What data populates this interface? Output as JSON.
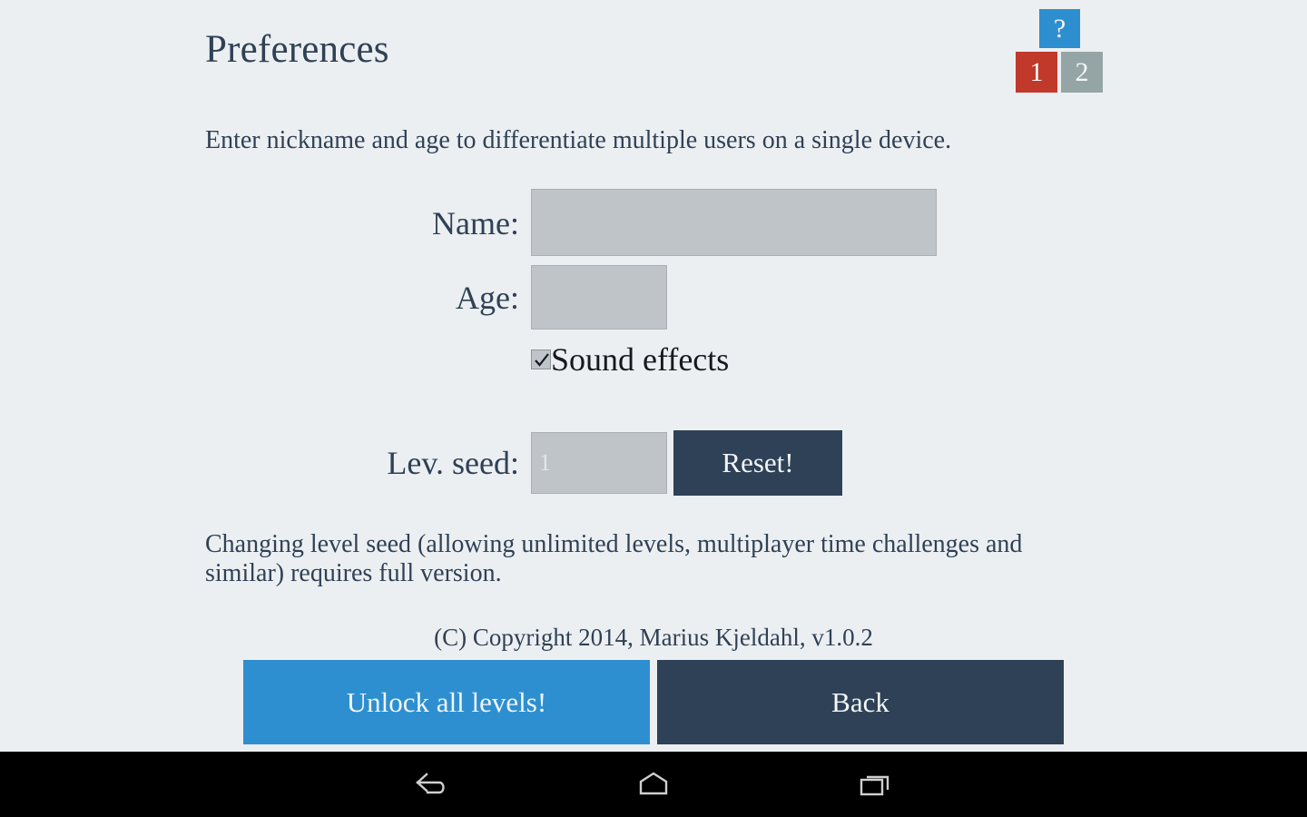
{
  "page": {
    "title": "Preferences",
    "intro": "Enter nickname and age to differentiate multiple users on a single device.",
    "seed_note": "Changing level seed (allowing unlimited levels, multiplayer time challenges and similar) requires full version.",
    "copyright": "(C) Copyright 2014, Marius Kjeldahl, v1.0.2",
    "background_color": "#eceff1",
    "text_color": "#2f4156"
  },
  "tiles": [
    {
      "label": "?",
      "name": "help-tile",
      "color": "#2e8fd0"
    },
    {
      "label": "1",
      "name": "level-tile-1",
      "color": "#c0392b"
    },
    {
      "label": "2",
      "name": "level-tile-2",
      "color": "#95a5a5"
    }
  ],
  "form": {
    "name": {
      "label": "Name:",
      "value": "",
      "placeholder": ""
    },
    "age": {
      "label": "Age:",
      "value": "",
      "placeholder": ""
    },
    "sound_effects": {
      "label": "Sound effects",
      "checked": true,
      "icon": "checkmark-icon"
    },
    "level_seed": {
      "label": "Lev. seed:",
      "value": "",
      "placeholder": "1"
    },
    "reset_label": "Reset!"
  },
  "buttons": {
    "unlock_label": "Unlock all levels!",
    "unlock_color": "#2e8fd0",
    "back_label": "Back",
    "back_color": "#2f4156"
  },
  "navbar": {
    "background_color": "#000000",
    "items": [
      {
        "name": "back-icon",
        "label": "Back"
      },
      {
        "name": "home-icon",
        "label": "Home"
      },
      {
        "name": "recents-icon",
        "label": "Recent apps"
      }
    ]
  }
}
